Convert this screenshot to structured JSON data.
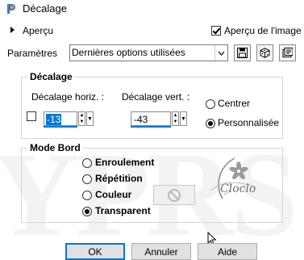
{
  "window": {
    "title": "Décalage",
    "app_icon": "paintshop-icon"
  },
  "preview": {
    "label": "Aperçu",
    "preview_image_label": "Aperçu de l'image",
    "preview_image_checked": true
  },
  "presets": {
    "label": "Paramètres",
    "selected": "Dernières options utilisées",
    "icons": [
      "save-preset-icon",
      "dice-randomize-icon",
      "reset-defaults-icon"
    ]
  },
  "offset": {
    "title": "Décalage",
    "horiz_label": "Décalage horiz. :",
    "horiz_value": "-13",
    "vert_label": "Décalage vert. :",
    "vert_value": "-43",
    "center_label": "Centrer",
    "custom_label": "Personnalisée",
    "selected": "custom",
    "link_checked": false
  },
  "edge_mode": {
    "title": "Mode Bord",
    "options": [
      "Enroulement",
      "Répétition",
      "Couleur",
      "Transparent"
    ],
    "selected": "Transparent"
  },
  "watermark": {
    "text": "Cloclo"
  },
  "buttons": {
    "ok": "OK",
    "cancel": "Annuler",
    "help": "Aide"
  },
  "colors": {
    "accent": "#0078d7",
    "icon_blue": "#2e7bd6",
    "icon_red": "#e6463c",
    "icon_orange": "#f0a21c"
  }
}
